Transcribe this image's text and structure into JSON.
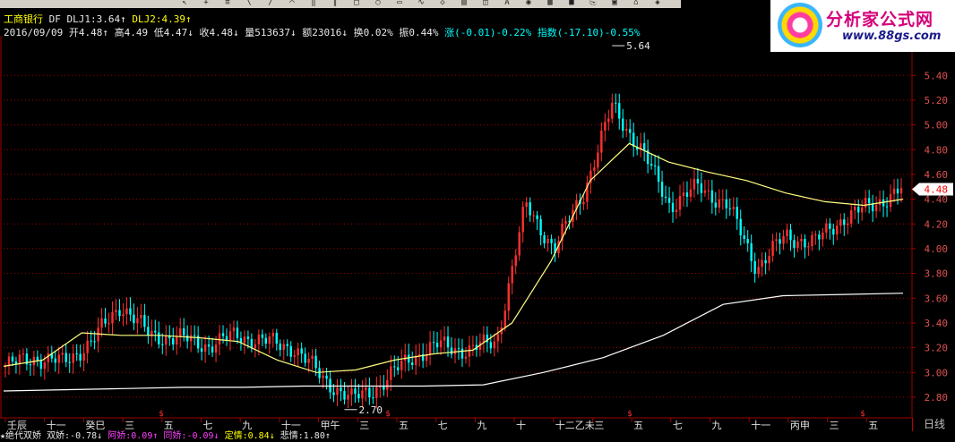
{
  "header": {
    "stock_name": "工商银行",
    "indicator_label": "DF",
    "dlj1": "DLJ1:3.64↑",
    "dlj2": "DLJ2:4.39↑",
    "date": "2016/09/09",
    "open": "开4.48↑",
    "high": "高4.49",
    "low": "低4.47↓",
    "close": "收4.48↓",
    "volume": "量513637↓",
    "amount": "额23016↓",
    "turnover": "换0.02%",
    "amplitude": "振0.44%",
    "change": "涨(-0.01)-0.22%",
    "index": "指数(-17.10)-0.55%"
  },
  "logo": {
    "brand": "分析家公式网",
    "site": "www.88gs.com"
  },
  "chart_data": {
    "type": "line",
    "y_ticks": [
      "5.40",
      "5.20",
      "5.00",
      "4.80",
      "4.60",
      "4.40",
      "4.20",
      "4.00",
      "3.80",
      "3.60",
      "3.40",
      "3.20",
      "3.00",
      "2.80"
    ],
    "ylim": [
      2.72,
      5.72
    ],
    "current_price_label": "4.48",
    "high_marker": "5.64",
    "low_marker": "2.70",
    "x_labels": [
      "壬辰",
      "十一",
      "癸巳",
      "三",
      "五",
      "七",
      "九",
      "十一",
      "甲午",
      "三",
      "五",
      "七",
      "九",
      "十",
      "十二乙未",
      "三",
      "五",
      "七",
      "九",
      "十一",
      "丙申",
      "三",
      "五"
    ],
    "price_series": [
      3.05,
      3.12,
      3.08,
      3.25,
      3.55,
      3.3,
      3.28,
      3.22,
      3.3,
      3.25,
      3.2,
      2.95,
      2.78,
      2.9,
      3.12,
      3.22,
      3.18,
      3.25,
      4.35,
      4.0,
      4.45,
      5.15,
      4.8,
      4.35,
      4.5,
      4.35,
      3.85,
      4.1,
      4.05,
      4.25,
      4.35,
      4.48
    ],
    "ma_yellow": [
      3.05,
      3.1,
      3.32,
      3.3,
      3.3,
      3.28,
      3.25,
      3.1,
      3.0,
      3.02,
      3.1,
      3.15,
      3.18,
      3.4,
      3.9,
      4.55,
      4.85,
      4.7,
      4.62,
      4.55,
      4.45,
      4.38,
      4.35,
      4.4
    ],
    "ma_white": [
      2.85,
      2.86,
      2.87,
      2.88,
      2.88,
      2.89,
      2.89,
      2.89,
      2.9,
      3.0,
      3.12,
      3.3,
      3.55,
      3.62,
      3.63,
      3.64
    ],
    "legend": [
      "DLJ1",
      "DLJ2"
    ]
  },
  "bottom_bar": {
    "title": "★绝代双娇",
    "items": [
      {
        "label": "双娇:-0.78↓",
        "color": "#e8e8e8"
      },
      {
        "label": "阿娇:0.09↑",
        "color": "#ff40ff"
      },
      {
        "label": "同娇:-0.09↓",
        "color": "#ff40ff"
      },
      {
        "label": "定情:0.84↓",
        "color": "#ffff00"
      },
      {
        "label": "悲情:1.80↑",
        "color": "#e8e8e8"
      }
    ]
  },
  "period_button": "日线",
  "colors": {
    "up": "#ff3030",
    "down": "#00ffff",
    "ma1": "#ffff80",
    "ma2": "#ffffff",
    "grid": "#a00000"
  }
}
